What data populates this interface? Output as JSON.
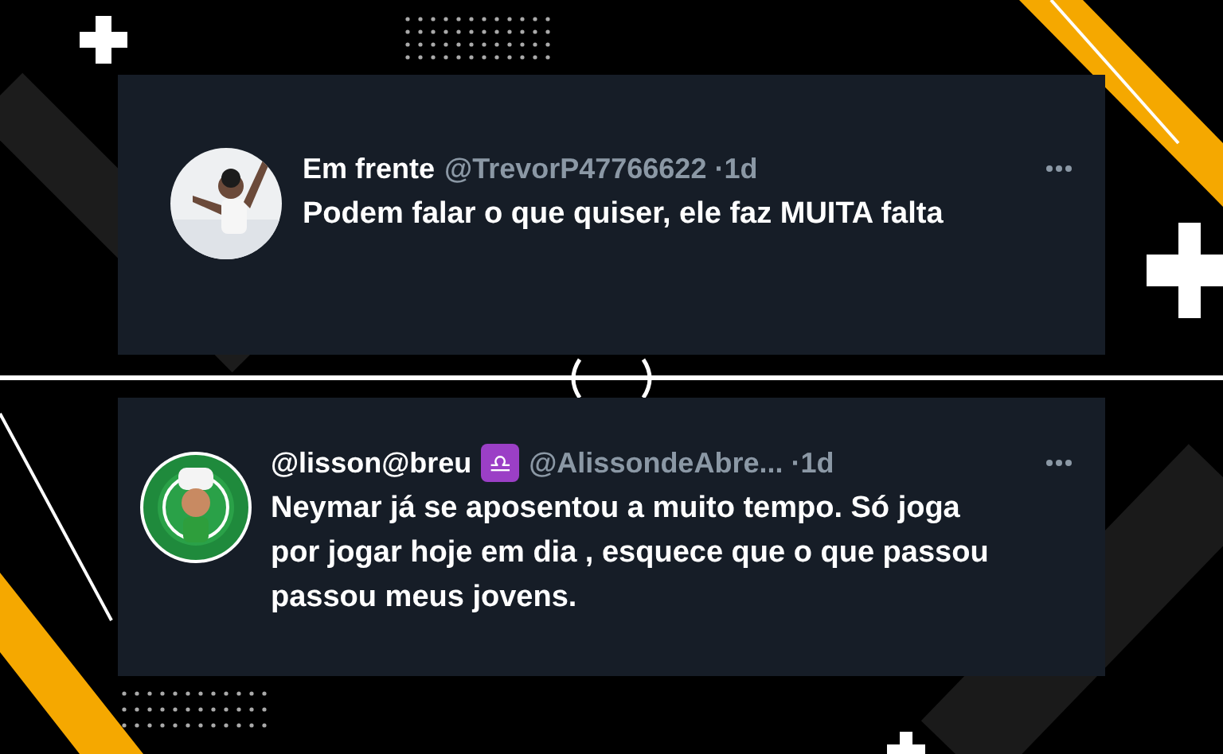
{
  "tweets": [
    {
      "name": "Em frente",
      "handle": "@TrevorP47766622",
      "time": "·1d",
      "text": "Podem falar o que quiser, ele faz MUITA falta"
    },
    {
      "name": "@lisson@breu",
      "badge": "♎",
      "handle": "@AlissondeAbre...",
      "time": "·1d",
      "text": "Neymar já se aposentou a muito tempo. Só joga por jogar hoje em dia , esquece que o que passou passou meus jovens."
    }
  ]
}
